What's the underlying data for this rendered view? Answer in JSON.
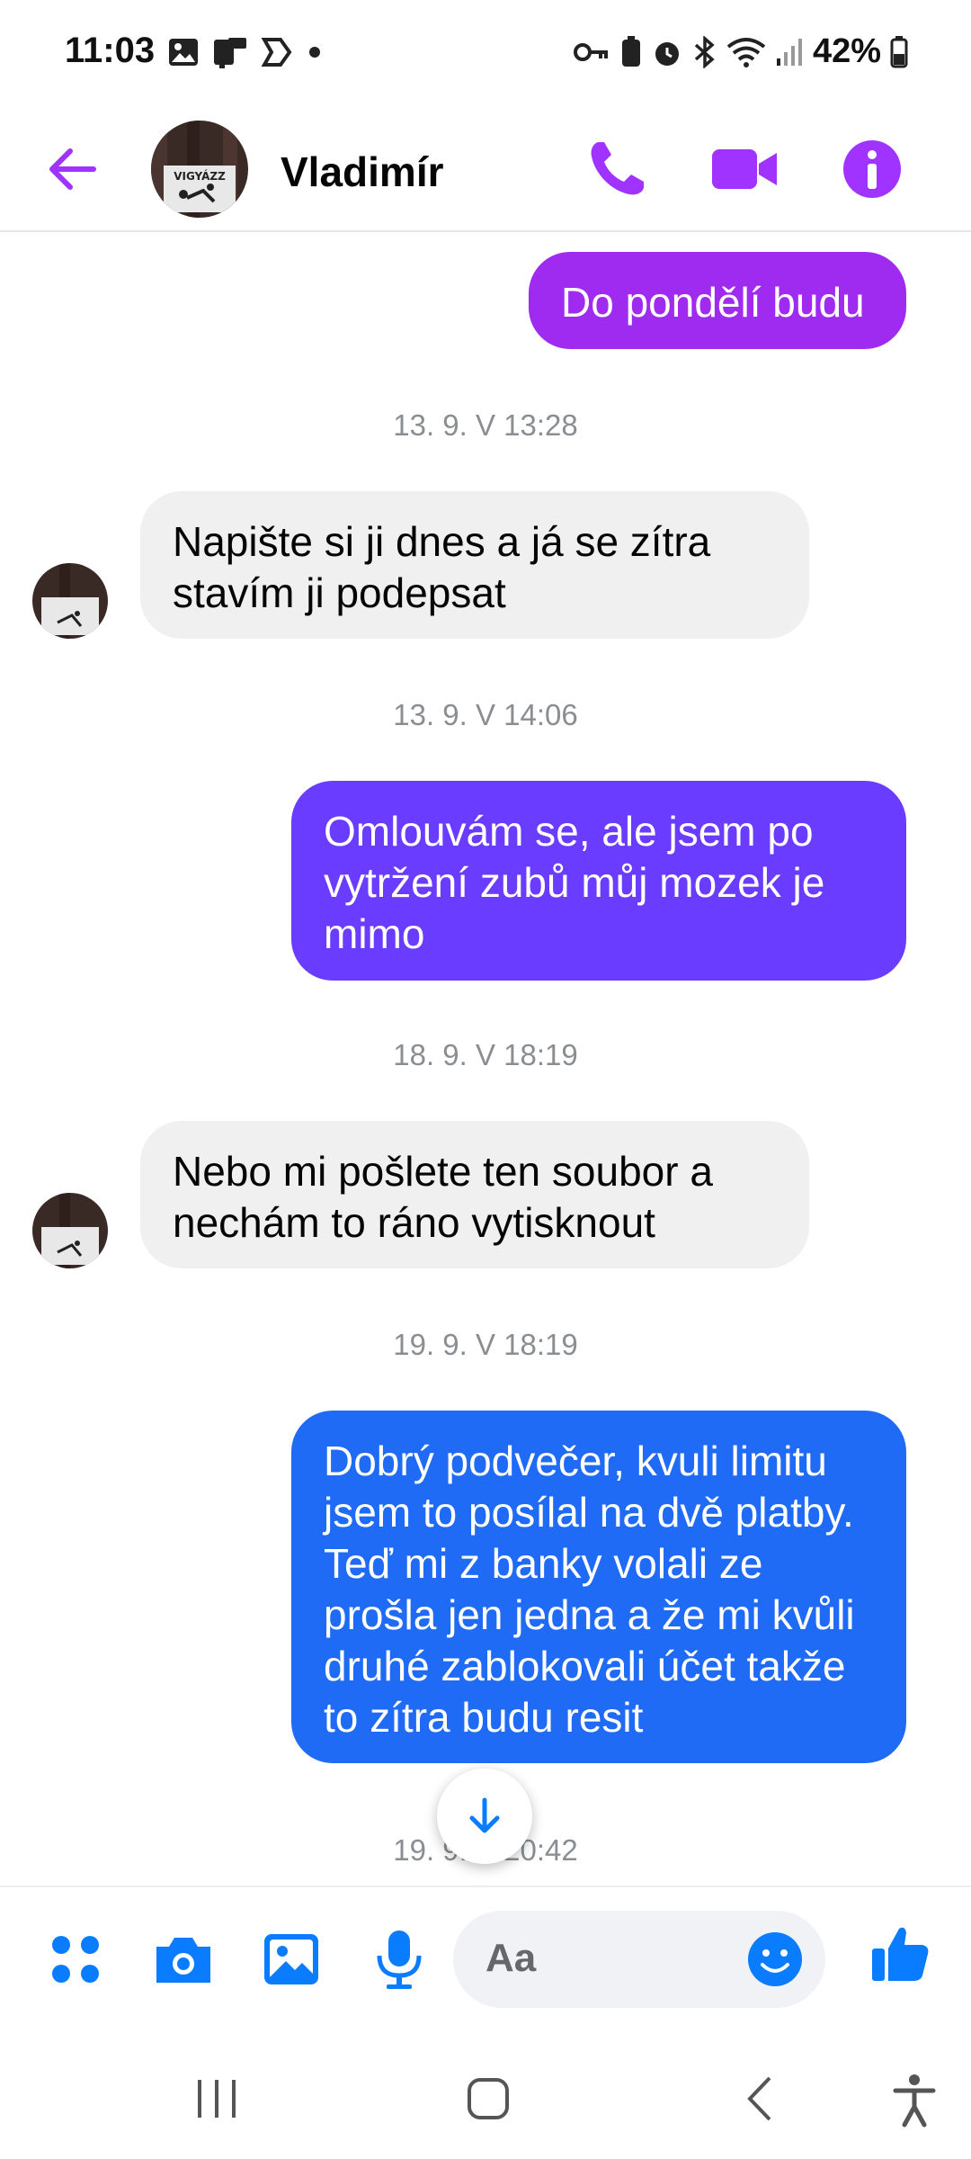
{
  "status_bar": {
    "time": "11:03",
    "battery": "42%"
  },
  "header": {
    "contact_name": "Vladimír",
    "avatar_text": "VIGYÁZZ"
  },
  "messages": [
    {
      "type": "outgoing",
      "text": "Do pondělí budu"
    },
    {
      "type": "timestamp",
      "text": "13. 9. V 13:28"
    },
    {
      "type": "incoming",
      "text": "Napište si ji dnes a já se zítra stavím ji podepsat"
    },
    {
      "type": "timestamp",
      "text": "13. 9. V 14:06"
    },
    {
      "type": "outgoing",
      "text": "Omlouvám se,  ale jsem po vytržení zubů můj mozek je mimo"
    },
    {
      "type": "timestamp",
      "text": "18. 9. V 18:19"
    },
    {
      "type": "incoming",
      "text": "Nebo mi pošlete ten soubor a nechám to ráno vytisknout"
    },
    {
      "type": "timestamp",
      "text": "19. 9. V 18:19"
    },
    {
      "type": "outgoing",
      "text": "Dobrý podvečer, kvuli limitu jsem to posílal na dvě platby. Teď mi z banky volali ze prošla jen jedna a že mi kvůli druhé zablokovali účet takže to zítra budu resit"
    },
    {
      "type": "timestamp",
      "text": "19. 9. V 20:42"
    }
  ],
  "composer": {
    "placeholder": "Aa"
  },
  "colors": {
    "accent_purple": "#a033ff",
    "bubble_gradient_top": "#a02bf0",
    "bubble_gradient_mid": "#6a3cff",
    "bubble_gradient_bottom": "#1f6bf5",
    "composer_blue": "#0a7cff",
    "incoming_bg": "#f0f0f0",
    "timestamp": "#8a8d91"
  },
  "icons": {
    "back": "arrow-left-icon",
    "call": "phone-icon",
    "video": "video-camera-icon",
    "info": "info-icon",
    "apps": "four-dots-icon",
    "camera": "camera-icon",
    "gallery": "image-icon",
    "mic": "microphone-icon",
    "emoji": "smiley-icon",
    "like": "thumbs-up-icon",
    "scroll": "arrow-down-icon"
  }
}
